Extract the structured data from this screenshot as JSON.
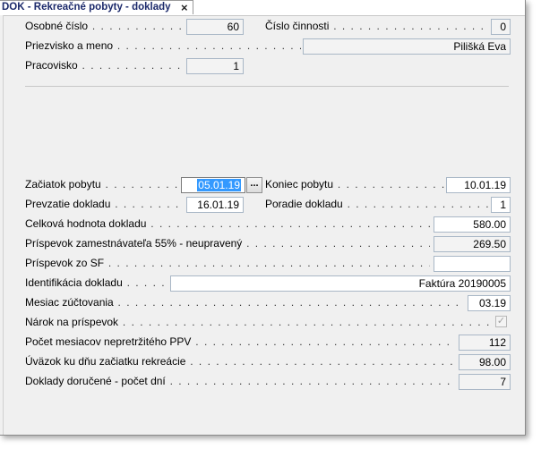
{
  "tab": {
    "title": "DOK - Rekreačné pobyty - doklady",
    "close_icon": "×"
  },
  "fields": {
    "osobne_cislo": {
      "label": "Osobné číslo",
      "value": "60"
    },
    "cislo_cinnosti": {
      "label": "Číslo činnosti",
      "value": "0"
    },
    "priezvisko": {
      "label": "Priezvisko a meno",
      "value": "Pilišká Eva"
    },
    "pracovisko": {
      "label": "Pracovisko",
      "value": "1"
    },
    "zaciatok": {
      "label": "Začiatok pobytu",
      "value": "05.01.19",
      "button": "..."
    },
    "koniec": {
      "label": "Koniec pobytu",
      "value": "10.01.19"
    },
    "prevzatie": {
      "label": "Prevzatie dokladu",
      "value": "16.01.19"
    },
    "poradie": {
      "label": "Poradie dokladu",
      "value": "1"
    },
    "hodnota": {
      "label": "Celková hodnota dokladu",
      "value": "580.00"
    },
    "prispevok_zam": {
      "label": "Príspevok zamestnávateľa 55% - neupravený",
      "value": "269.50"
    },
    "prispevok_sf": {
      "label": "Príspevok zo SF",
      "value": ""
    },
    "identifikacia": {
      "label": "Identifikácia dokladu",
      "value": "Faktúra 20190005"
    },
    "mesiac": {
      "label": "Mesiac zúčtovania",
      "value": "03.19"
    },
    "narok": {
      "label": "Nárok na príspevok",
      "checked": true
    },
    "pocet_mesiacov": {
      "label": "Počet mesiacov nepretržitého PPV",
      "value": "112"
    },
    "uvazok": {
      "label": "Úväzok ku dňu začiatku rekreácie",
      "value": "98.00"
    },
    "doklady": {
      "label": "Doklady doručené - počet dní",
      "value": "7"
    }
  }
}
